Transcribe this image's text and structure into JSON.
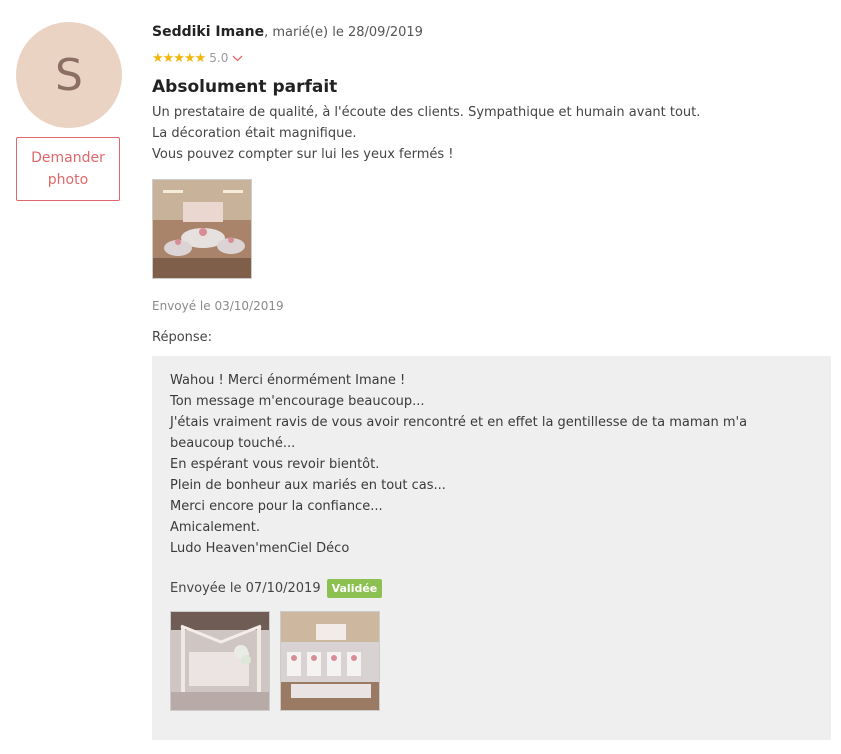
{
  "reviewer": {
    "initial": "S",
    "name": "Seddiki Imane",
    "meta": ", marié(e) le 28/09/2019"
  },
  "ask_photo_label": "Demander photo",
  "rating": {
    "stars": "★★★★★",
    "value": "5.0",
    "fraction": 1.0
  },
  "review": {
    "title": "Absolument parfait",
    "lines": [
      "Un prestataire de qualité, à l'écoute des clients. Sympathique et humain avant tout.",
      "La décoration était magnifique.",
      "Vous pouvez compter sur lui les yeux fermés !"
    ],
    "sent": "Envoyé le 03/10/2019"
  },
  "reply": {
    "label": "Réponse:",
    "lines": [
      "Wahou ! Merci énormément Imane !",
      "Ton message m'encourage beaucoup...",
      "J'étais vraiment ravis de vous avoir rencontré et en effet la gentillesse de ta maman m'a beaucoup touché...",
      "En espérant vous revoir bientôt.",
      "Plein de bonheur aux mariés en tout cas...",
      "Merci encore pour la confiance...",
      "Amicalement.",
      "Ludo Heaven'menCiel Déco"
    ],
    "sent": "Envoyée le 07/10/2019",
    "status": "Validée"
  },
  "colors": {
    "accent": "#e0686a",
    "star": "#f1b60a",
    "badge": "#8cc152",
    "avatar_bg": "#ead3c3",
    "reply_bg": "#efefef"
  }
}
